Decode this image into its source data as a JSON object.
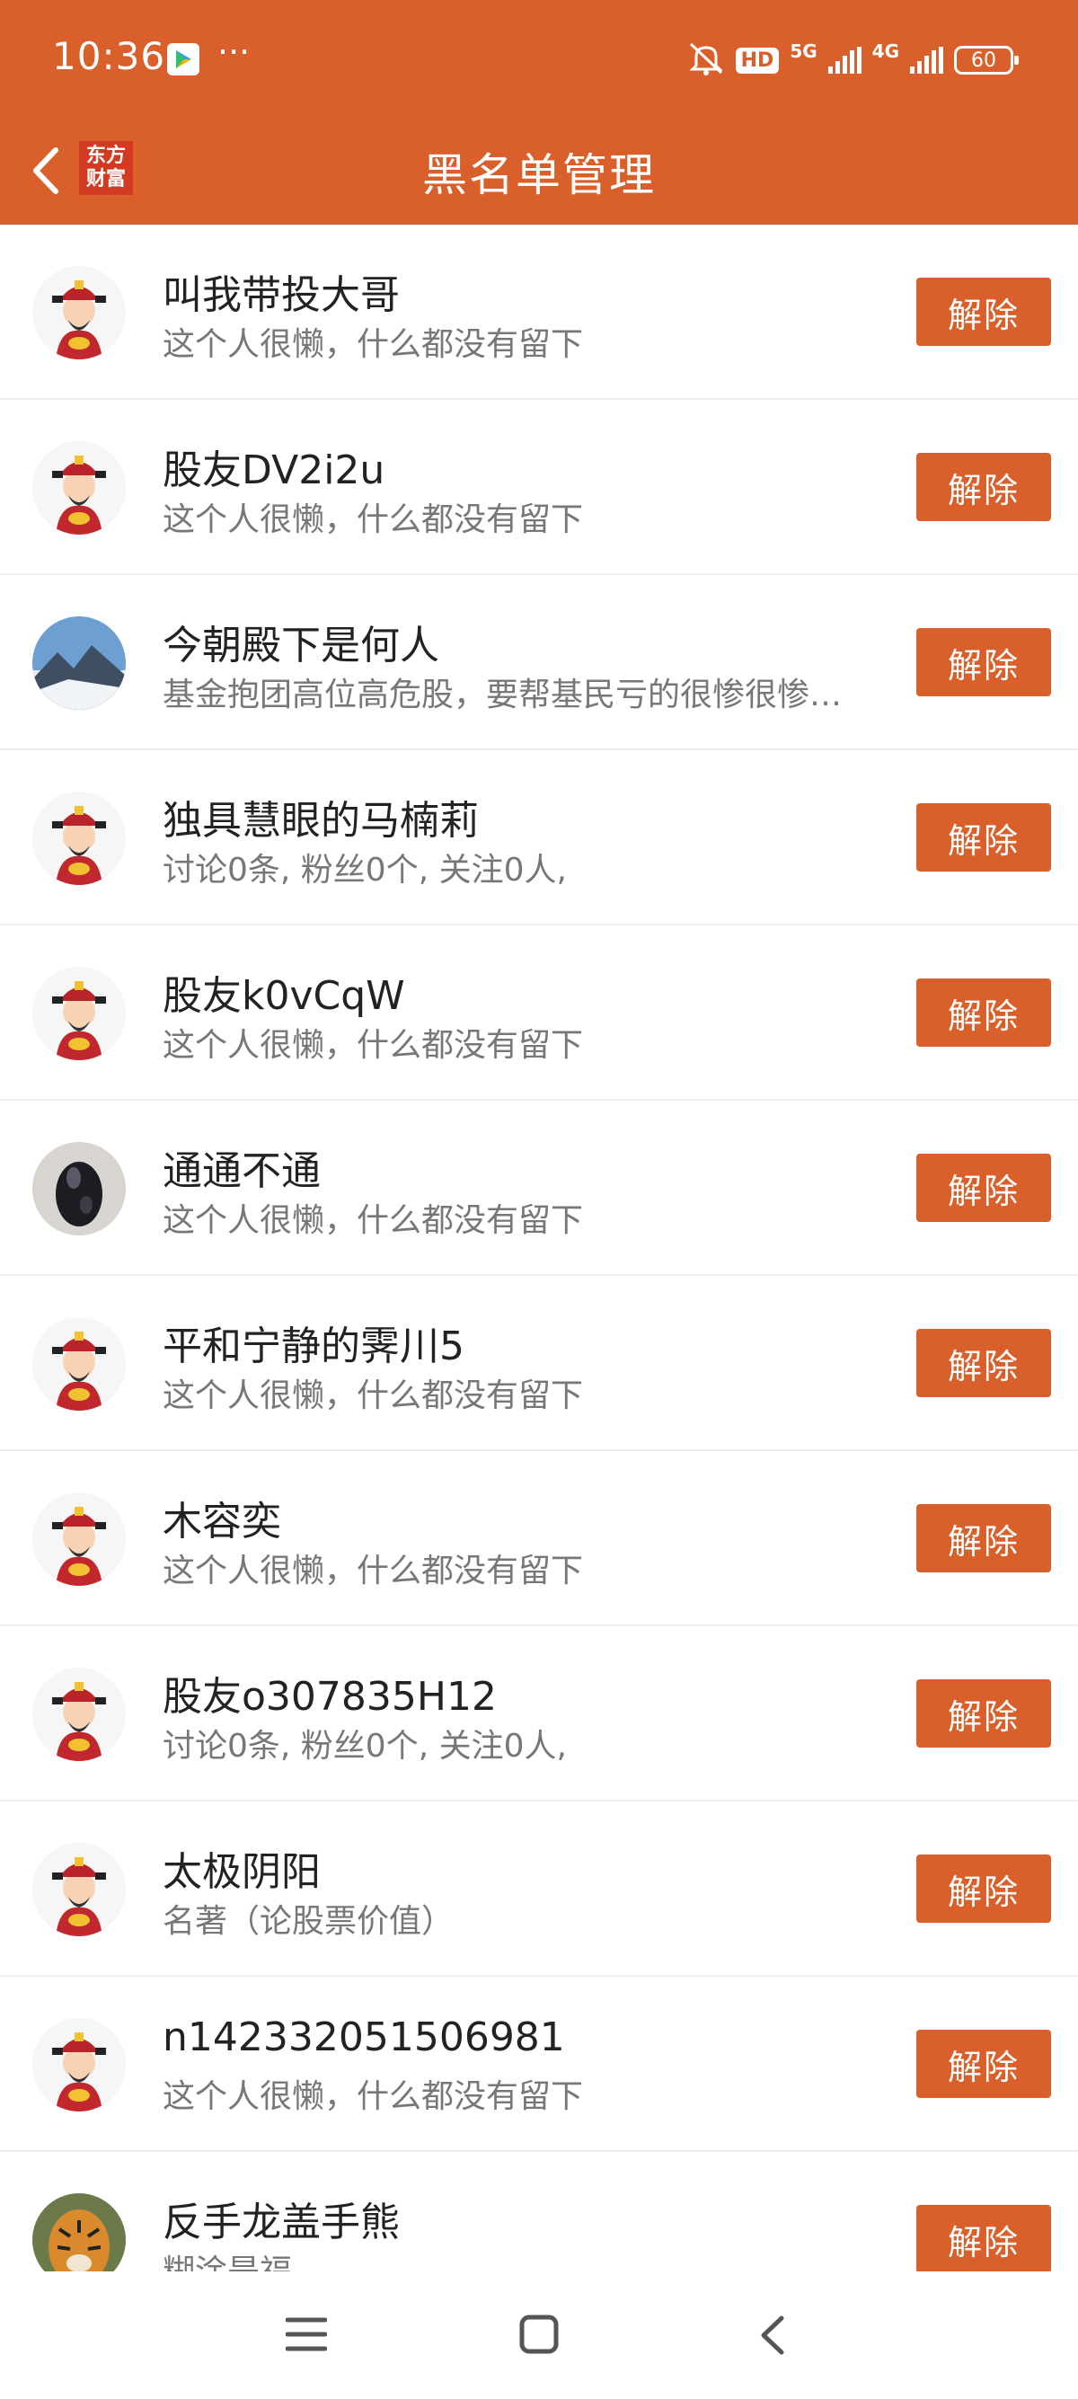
{
  "status_bar": {
    "time": "10:36",
    "more": "···",
    "hd_label": "HD",
    "net_5g": "5G",
    "net_4g": "4G",
    "battery": "60"
  },
  "header": {
    "logo_line1": "东方",
    "logo_line2": "财富",
    "title": "黑名单管理"
  },
  "colors": {
    "accent": "#D9602A"
  },
  "rows": [
    {
      "name": "叫我带投大哥",
      "desc": "这个人很懒，什么都没有留下",
      "action": "解除",
      "avatar": "default"
    },
    {
      "name": "股友DV2i2u",
      "desc": "这个人很懒，什么都没有留下",
      "action": "解除",
      "avatar": "default"
    },
    {
      "name": "今朝殿下是何人",
      "desc": "基金抱团高位高危股，要帮基民亏的很惨很惨…",
      "action": "解除",
      "avatar": "mountain"
    },
    {
      "name": "独具慧眼的马楠莉",
      "desc": "讨论0条, 粉丝0个, 关注0人,",
      "action": "解除",
      "avatar": "default"
    },
    {
      "name": "股友k0vCqW",
      "desc": "这个人很懒，什么都没有留下",
      "action": "解除",
      "avatar": "default"
    },
    {
      "name": "通通不通",
      "desc": "这个人很懒，什么都没有留下",
      "action": "解除",
      "avatar": "figure"
    },
    {
      "name": "平和宁静的霁川5",
      "desc": "这个人很懒，什么都没有留下",
      "action": "解除",
      "avatar": "default"
    },
    {
      "name": "木容奕",
      "desc": "这个人很懒，什么都没有留下",
      "action": "解除",
      "avatar": "default"
    },
    {
      "name": "股友o307835H12",
      "desc": "讨论0条, 粉丝0个, 关注0人,",
      "action": "解除",
      "avatar": "default"
    },
    {
      "name": "太极阴阳",
      "desc": "名著（论股票价值）",
      "action": "解除",
      "avatar": "default"
    },
    {
      "name": "n142332051506981",
      "desc": "这个人很懒，什么都没有留下",
      "action": "解除",
      "avatar": "default"
    },
    {
      "name": "反手龙盖手熊",
      "desc": "糊涂是福",
      "action": "解除",
      "avatar": "tiger"
    }
  ]
}
